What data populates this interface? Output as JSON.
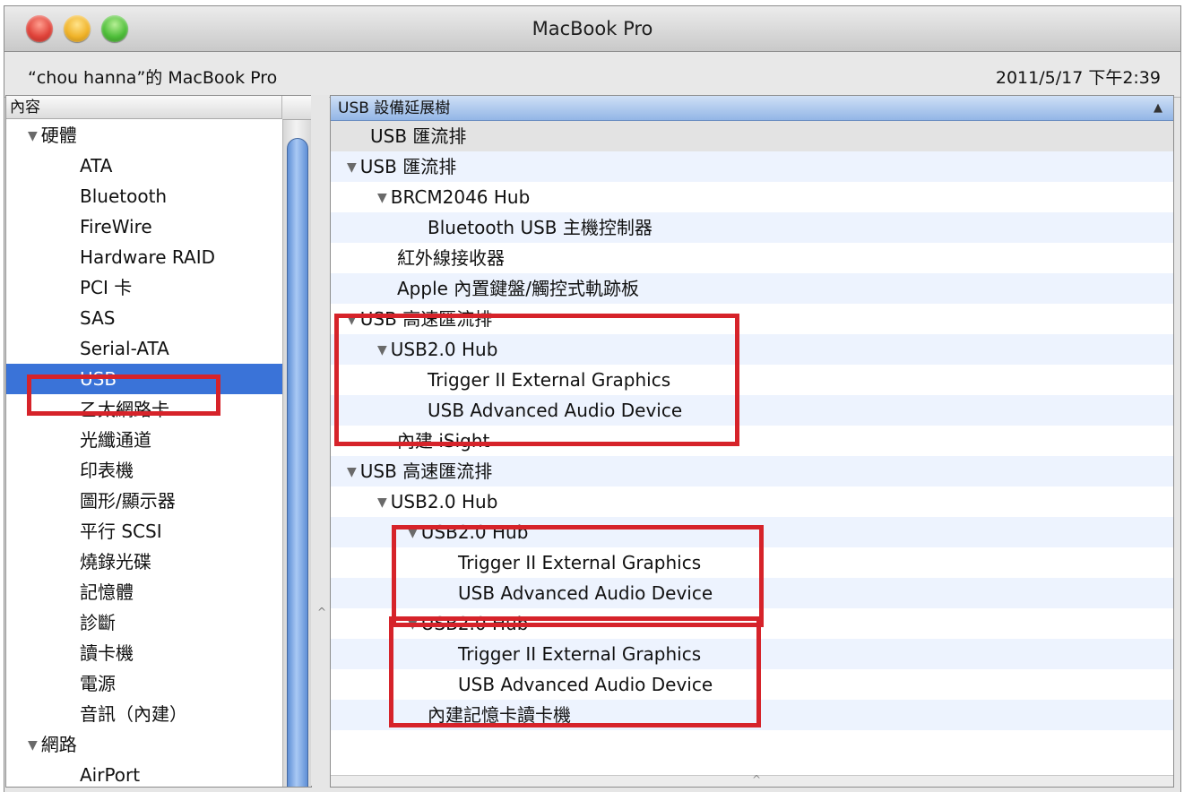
{
  "window": {
    "title": "MacBook Pro"
  },
  "info": {
    "machine_name": "“chou hanna”的 MacBook Pro",
    "datetime": "2011/5/17 下午2:39"
  },
  "sidebar": {
    "header": "內容",
    "triangle_glyph": "▼",
    "items": [
      {
        "label": "硬體",
        "type": "category"
      },
      {
        "label": "ATA",
        "type": "item"
      },
      {
        "label": "Bluetooth",
        "type": "item"
      },
      {
        "label": "FireWire",
        "type": "item"
      },
      {
        "label": "Hardware RAID",
        "type": "item"
      },
      {
        "label": "PCI 卡",
        "type": "item"
      },
      {
        "label": "SAS",
        "type": "item"
      },
      {
        "label": "Serial-ATA",
        "type": "item"
      },
      {
        "label": "USB",
        "type": "item",
        "selected": true
      },
      {
        "label": "乙太網路卡",
        "type": "item"
      },
      {
        "label": "光纖通道",
        "type": "item"
      },
      {
        "label": "印表機",
        "type": "item"
      },
      {
        "label": "圖形/顯示器",
        "type": "item"
      },
      {
        "label": "平行 SCSI",
        "type": "item"
      },
      {
        "label": "燒錄光碟",
        "type": "item"
      },
      {
        "label": "記憶體",
        "type": "item"
      },
      {
        "label": "診斷",
        "type": "item"
      },
      {
        "label": "讀卡機",
        "type": "item"
      },
      {
        "label": "電源",
        "type": "item"
      },
      {
        "label": "音訊（內建）",
        "type": "item"
      },
      {
        "label": "網路",
        "type": "category"
      },
      {
        "label": "AirPort",
        "type": "item"
      }
    ]
  },
  "main": {
    "header": "USB 設備延展樹",
    "sort_glyph": "▲",
    "rows": [
      {
        "label": "USB 匯流排",
        "level": 0,
        "expanded": false,
        "style": "hdr"
      },
      {
        "label": "USB 匯流排",
        "level": 0,
        "expanded": true
      },
      {
        "label": "BRCM2046 Hub",
        "level": 1,
        "expanded": true
      },
      {
        "label": "Bluetooth USB 主機控制器",
        "level": 2
      },
      {
        "label": "紅外線接收器",
        "level": 1
      },
      {
        "label": "Apple 內置鍵盤/觸控式軌跡板",
        "level": 1
      },
      {
        "label": "USB 高速匯流排",
        "level": 0,
        "expanded": true
      },
      {
        "label": "USB2.0 Hub",
        "level": 1,
        "expanded": true
      },
      {
        "label": "Trigger II External Graphics",
        "level": 2
      },
      {
        "label": "USB Advanced Audio Device",
        "level": 2
      },
      {
        "label": "內建 iSight",
        "level": 1
      },
      {
        "label": "USB 高速匯流排",
        "level": 0,
        "expanded": true
      },
      {
        "label": "USB2.0 Hub",
        "level": 1,
        "expanded": true
      },
      {
        "label": "USB2.0 Hub",
        "level": 2,
        "expanded": true
      },
      {
        "label": "Trigger II External Graphics",
        "level": 3
      },
      {
        "label": "USB Advanced Audio Device",
        "level": 3
      },
      {
        "label": "USB2.0 Hub",
        "level": 2,
        "expanded": true
      },
      {
        "label": "Trigger II External Graphics",
        "level": 3
      },
      {
        "label": "USB Advanced Audio Device",
        "level": 3
      },
      {
        "label": "內建記憶卡讀卡機",
        "level": 2
      }
    ]
  },
  "colors": {
    "selection": "#3a73d8",
    "highlight_box": "#d6232a",
    "zebra_row": "#edf3fe"
  }
}
